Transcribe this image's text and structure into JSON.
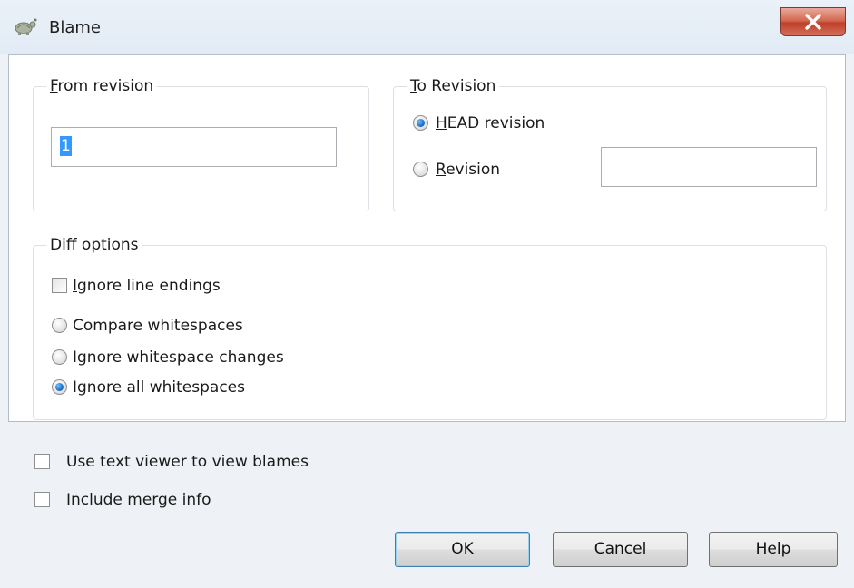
{
  "window": {
    "title": "Blame"
  },
  "from_revision": {
    "group_label": "From revision",
    "value": "1"
  },
  "to_revision": {
    "group_label": "To Revision",
    "head_label": "HEAD revision",
    "revision_label": "Revision",
    "revision_value": "",
    "selected": "head"
  },
  "diff_options": {
    "group_label": "Diff options",
    "ignore_line_endings": {
      "label": "Ignore line endings",
      "checked": false
    },
    "compare_whitespaces": "Compare whitespaces",
    "ignore_whitespace_changes": "Ignore whitespace changes",
    "ignore_all_whitespaces": "Ignore all whitespaces",
    "selected": "ignore_all_whitespaces"
  },
  "options": {
    "use_text_viewer": {
      "label": "Use text viewer to view blames",
      "checked": false
    },
    "include_merge_info": {
      "label": "Include merge info",
      "checked": false
    }
  },
  "buttons": {
    "ok": "OK",
    "cancel": "Cancel",
    "help": "Help"
  },
  "icons": {
    "app": "tortoise-icon",
    "close": "close-icon"
  },
  "colors": {
    "selection": "#3399ff",
    "close_button": "#c7432c"
  }
}
